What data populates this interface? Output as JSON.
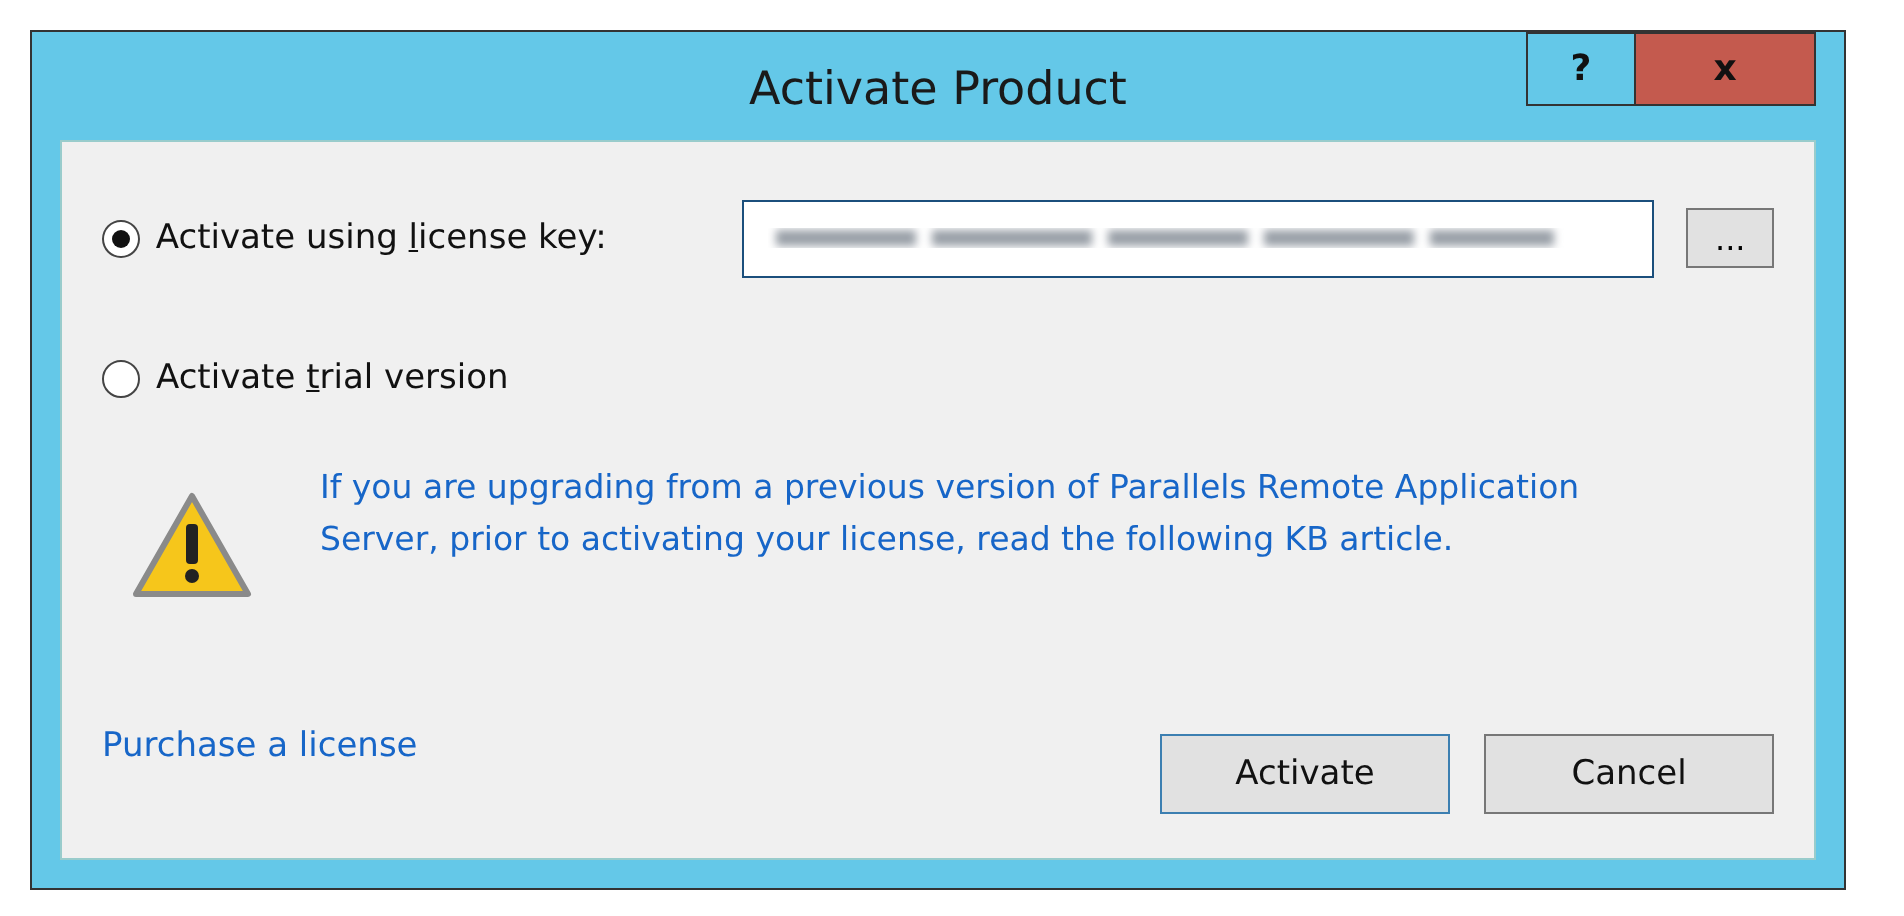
{
  "window": {
    "title": "Activate Product",
    "buttons": [
      {
        "label": "?",
        "kind": "help"
      },
      {
        "label": "x",
        "kind": "close"
      }
    ]
  },
  "options": [
    {
      "label": {
        "before": "Activate using ",
        "key": "l",
        "after": "icense key:"
      },
      "selected": true,
      "kind": "key"
    },
    {
      "label": {
        "before": "Activate ",
        "key": "t",
        "after": "rial version"
      },
      "selected": false,
      "kind": "plain"
    }
  ],
  "browse_button": {
    "label": "..."
  },
  "warning": {
    "text": "If you are upgrading from a previous version of Parallels Remote Application Server, prior to activating your license, read the following KB article."
  },
  "link": "Purchase a license",
  "buttons": [
    {
      "label": "Activate",
      "default": true
    },
    {
      "label": "Cancel",
      "default": false
    }
  ]
}
